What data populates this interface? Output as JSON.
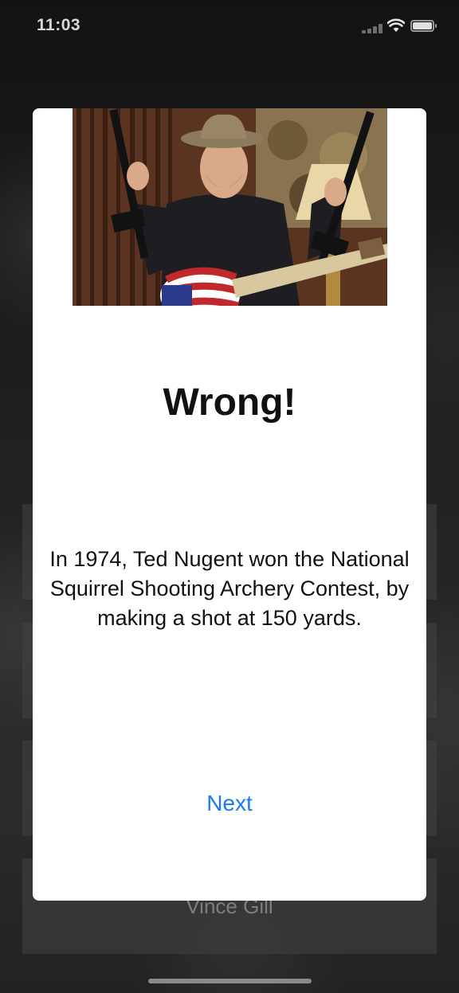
{
  "status_bar": {
    "time": "11:03"
  },
  "answers": [
    {
      "label": ""
    },
    {
      "label": ""
    },
    {
      "label": ""
    },
    {
      "label": "Vince Gill"
    }
  ],
  "modal": {
    "result_title": "Wrong!",
    "fact_text": "In 1974, Ted Nugent won the National Squirrel Shooting Archery Contest, by making a shot at 150 yards.",
    "next_label": "Next"
  },
  "colors": {
    "accent": "#1a7cf2",
    "modal_bg": "#ffffff"
  }
}
